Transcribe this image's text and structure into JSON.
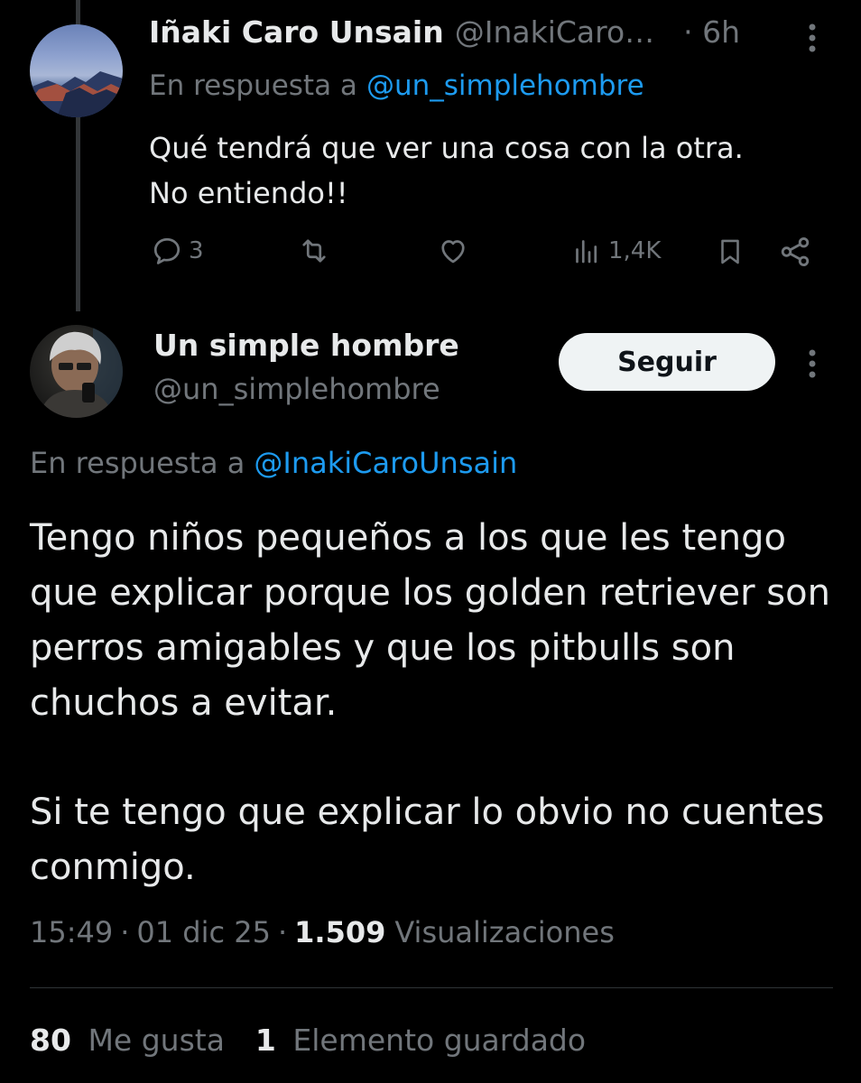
{
  "tweet1": {
    "name": "Iñaki Caro Unsain",
    "handle": "@InakiCaro…",
    "time": "· 6h",
    "reply_prefix": "En respuesta a",
    "reply_to": "@un_simplehombre",
    "text": "Qué tendrá que ver una cosa con la otra.\nNo entiendo!!",
    "replies": "3",
    "views": "1,4K"
  },
  "tweet2": {
    "name": "Un simple hombre",
    "handle": "@un_simplehombre",
    "follow_label": "Seguir",
    "reply_prefix": "En respuesta a",
    "reply_to": "@InakiCaroUnsain",
    "paragraph1": "Tengo niños pequeños a los que les tengo que explicar porque los golden retriever son perros amigables y que los pitbulls son chuchos a evitar.",
    "paragraph2": "Si te tengo que explicar lo obvio no cuentes conmigo.",
    "time": "15:49",
    "date": "01 dic 25",
    "views_count": "1.509",
    "views_label": "Visualizaciones",
    "likes_count": "80",
    "likes_label": "Me gusta",
    "saved_count": "1",
    "saved_label": "Elemento guardado"
  },
  "icons": {
    "reply": "reply-icon",
    "retweet": "retweet-icon",
    "like": "like-icon",
    "views": "views-icon",
    "bookmark": "bookmark-icon",
    "share": "share-icon",
    "more": "more-icon"
  },
  "colors": {
    "background": "#000000",
    "text": "#e7e9ea",
    "muted": "#71767b",
    "link": "#1d9bf0",
    "follow_bg": "#eff3f4"
  }
}
